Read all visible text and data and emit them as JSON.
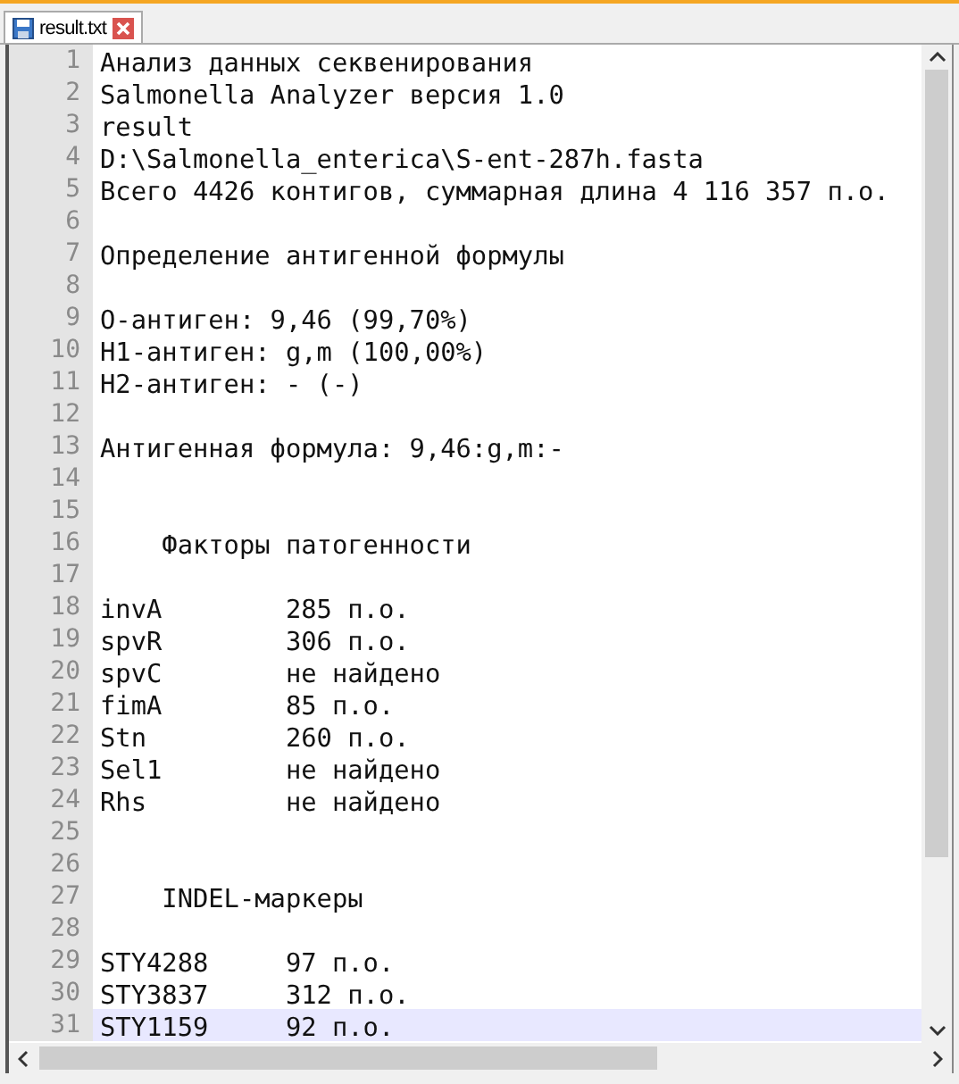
{
  "tabs": [
    {
      "title": "result.txt",
      "selected": true
    }
  ],
  "editor": {
    "lines": [
      {
        "number": "1",
        "text": "Анализ данных секвенирования",
        "current": false
      },
      {
        "number": "2",
        "text": "Salmonella Analyzer версия 1.0",
        "current": false
      },
      {
        "number": "3",
        "text": "result",
        "current": false
      },
      {
        "number": "4",
        "text": "D:\\Salmonella_enterica\\S-ent-287h.fasta",
        "current": false
      },
      {
        "number": "5",
        "text": "Всего 4426 контигов, суммарная длина 4 116 357 п.о.",
        "current": false
      },
      {
        "number": "6",
        "current": false
      },
      {
        "number": "7",
        "text": "Определение антигенной формулы",
        "current": false
      },
      {
        "number": "8",
        "current": false
      },
      {
        "number": "9",
        "text": "O-антиген: 9,46 (99,70%)",
        "current": false
      },
      {
        "number": "10",
        "text": "H1-антиген: g,m (100,00%)",
        "current": false
      },
      {
        "number": "11",
        "text": "H2-антиген: - (-)",
        "current": false
      },
      {
        "number": "12",
        "current": false
      },
      {
        "number": "13",
        "text": "Антигенная формула: 9,46:g,m:-",
        "current": false
      },
      {
        "number": "14",
        "current": false
      },
      {
        "number": "15",
        "current": false
      },
      {
        "number": "16",
        "text": "    Факторы патогенности",
        "current": false
      },
      {
        "number": "17",
        "current": false
      },
      {
        "number": "18",
        "text": "invA        285 п.о.",
        "current": false
      },
      {
        "number": "19",
        "text": "spvR        306 п.о.",
        "current": false
      },
      {
        "number": "20",
        "text": "spvC        не найдено",
        "current": false
      },
      {
        "number": "21",
        "text": "fimA        85 п.о.",
        "current": false
      },
      {
        "number": "22",
        "text": "Stn         260 п.о.",
        "current": false
      },
      {
        "number": "23",
        "text": "Sel1        не найдено",
        "current": false
      },
      {
        "number": "24",
        "text": "Rhs         не найдено",
        "current": false
      },
      {
        "number": "25",
        "current": false
      },
      {
        "number": "26",
        "current": false
      },
      {
        "number": "27",
        "text": "    INDEL-маркеры",
        "current": false
      },
      {
        "number": "28",
        "current": false
      },
      {
        "number": "29",
        "text": "STY4288     97 п.о.",
        "current": false
      },
      {
        "number": "30",
        "text": "STY3837     312 п.о.",
        "current": false
      },
      {
        "number": "31",
        "text": "STY1159     92 п.о.",
        "current": true
      }
    ]
  }
}
